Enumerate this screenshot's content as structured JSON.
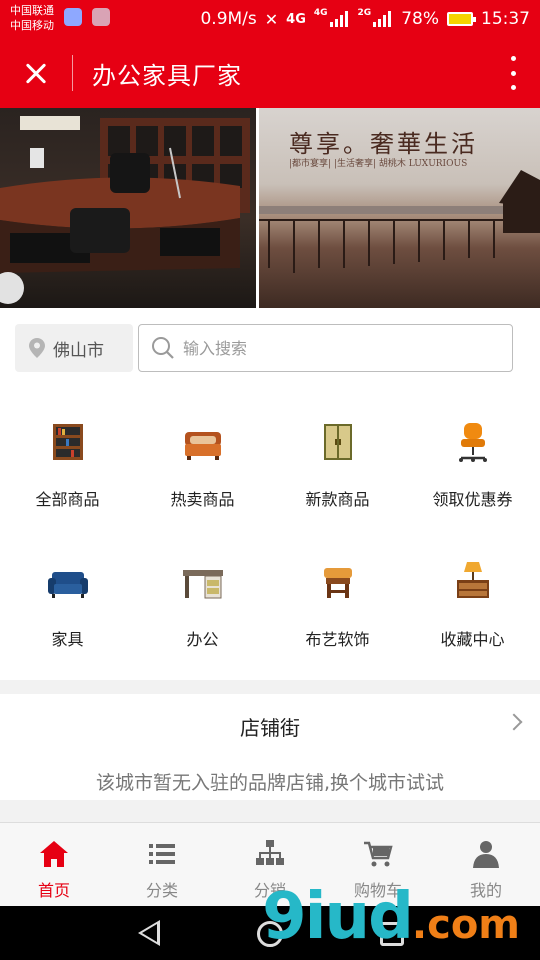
{
  "status_bar": {
    "carrier_1": "中国联通",
    "carrier_2": "中国移动",
    "speed": "0.9M/s",
    "net_4g": "4G",
    "net_4g_small": "4G",
    "net_2g": "2G",
    "battery": "78%",
    "time": "15:37"
  },
  "title_bar": {
    "title": "办公家具厂家",
    "close_icon": "close-icon",
    "more_icon": "more-vertical-icon"
  },
  "banner": {
    "left_badge": "",
    "right_headline": "尊享。奢華生活",
    "right_tagline": "|都市宴享| |生活奢享| 胡桃木 LUXURIOUS"
  },
  "search": {
    "city": "佛山市",
    "placeholder": "输入搜索",
    "value": ""
  },
  "categories": [
    {
      "label": "全部商品",
      "icon": "bookshelf-icon"
    },
    {
      "label": "热卖商品",
      "icon": "sofa-bed-icon"
    },
    {
      "label": "新款商品",
      "icon": "wardrobe-icon"
    },
    {
      "label": "领取优惠券",
      "icon": "office-chair-icon"
    },
    {
      "label": "家具",
      "icon": "sofa-icon"
    },
    {
      "label": "办公",
      "icon": "desk-icon"
    },
    {
      "label": "布艺软饰",
      "icon": "stool-icon"
    },
    {
      "label": "收藏中心",
      "icon": "nightstand-lamp-icon"
    }
  ],
  "store_street": {
    "title": "店铺街",
    "message": "该城市暂无入驻的品牌店铺,换个城市试试"
  },
  "tabs": [
    {
      "label": "首页",
      "icon": "home-icon",
      "active": true
    },
    {
      "label": "分类",
      "icon": "list-icon",
      "active": false
    },
    {
      "label": "分销",
      "icon": "hierarchy-icon",
      "active": false
    },
    {
      "label": "购物车",
      "icon": "cart-icon",
      "active": false
    },
    {
      "label": "我的",
      "icon": "user-icon",
      "active": false
    }
  ],
  "watermark": {
    "main": "9iud",
    "domain": ".com"
  },
  "colors": {
    "brand_red": "#e60013",
    "tab_inactive": "#888888"
  }
}
